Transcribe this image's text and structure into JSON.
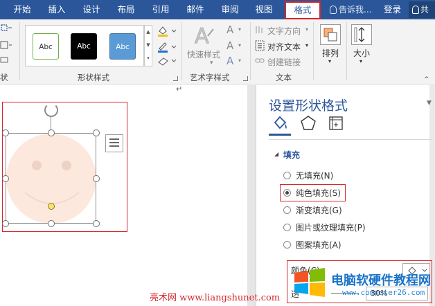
{
  "tabs": [
    {
      "label": "开始",
      "active": false
    },
    {
      "label": "插入",
      "active": false
    },
    {
      "label": "设计",
      "active": false
    },
    {
      "label": "布局",
      "active": false
    },
    {
      "label": "引用",
      "active": false
    },
    {
      "label": "邮件",
      "active": false
    },
    {
      "label": "审阅",
      "active": false
    },
    {
      "label": "视图",
      "active": false
    },
    {
      "label": "格式",
      "active": true
    }
  ],
  "header": {
    "tell_me": "告诉我...",
    "login": "登录",
    "share": "共"
  },
  "ribbon": {
    "left_group_label": "状",
    "shape_styles": {
      "label": "形状样式",
      "swatches": [
        "Abc",
        "Abc",
        "Abc"
      ]
    },
    "art_text": {
      "label": "艺术字样式",
      "quick_styles": "快速样式",
      "glyph": "A"
    },
    "text_group": {
      "label": "文本",
      "direction": "文字方向",
      "align": "对齐文本",
      "link": "创建链接"
    },
    "arrange": {
      "label": "排列"
    },
    "size": {
      "label": "大小"
    }
  },
  "pane": {
    "title": "设置形状格式",
    "section": "填充",
    "options": [
      {
        "label": "无填充(N)",
        "selected": false
      },
      {
        "label": "纯色填充(S)",
        "selected": true
      },
      {
        "label": "渐变填充(G)",
        "selected": false
      },
      {
        "label": "图片或纹理填充(P)",
        "selected": false
      },
      {
        "label": "图案填充(A)",
        "selected": false
      }
    ],
    "color_label": "颜色(C)",
    "transparency_label": "透",
    "transparency_value": "30%"
  },
  "watermarks": {
    "left": "亮术网 www.liangshunet.com",
    "right": "电脑软硬件教程网",
    "right_url": "www.computer26.com"
  },
  "colors": {
    "accent": "#2b579a",
    "highlight": "#d6262e",
    "face": "#fde8de"
  }
}
